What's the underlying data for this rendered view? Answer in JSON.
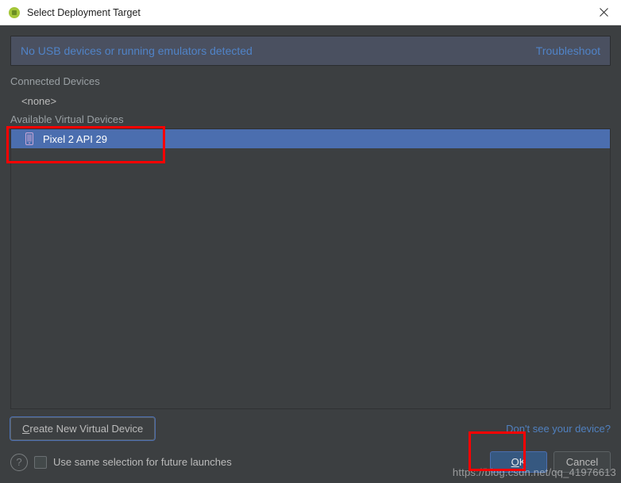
{
  "window": {
    "title": "Select Deployment Target"
  },
  "banner": {
    "message": "No USB devices or running emulators detected",
    "troubleshoot": "Troubleshoot"
  },
  "sections": {
    "connected_label": "Connected Devices",
    "connected_none": "<none>",
    "available_label": "Available Virtual Devices"
  },
  "devices": {
    "virtual": [
      {
        "name": "Pixel 2 API 29",
        "selected": true
      }
    ]
  },
  "actions": {
    "create_new": "Create New Virtual Device",
    "dont_see": "Don't see your device?",
    "use_same": "Use same selection for future launches",
    "ok": "OK",
    "cancel": "Cancel",
    "help": "?"
  },
  "watermark": "https://blog.csdn.net/qq_41976613"
}
